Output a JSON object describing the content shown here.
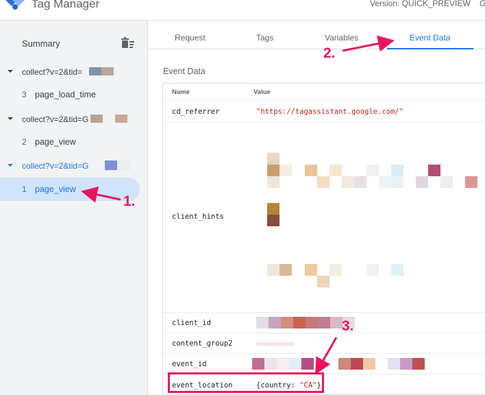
{
  "header": {
    "app_title": "Tag Manager",
    "version": "Version: QUICK_PREVIEW",
    "trailing": "G"
  },
  "sidebar": {
    "summary_label": "Summary",
    "clear_icon": "clear-list-icon",
    "requests": [
      {
        "label": "collect?v=2&tid=",
        "events": [
          {
            "number": "3",
            "name": "page_load_time"
          }
        ]
      },
      {
        "label": "collect?v=2&tid=G",
        "events": [
          {
            "number": "2",
            "name": "page_view"
          }
        ]
      },
      {
        "label": "collect?v=2&tid=G",
        "active": true,
        "events": [
          {
            "number": "1",
            "name": "page_view",
            "selected": true
          }
        ]
      }
    ]
  },
  "tabs": [
    {
      "label": "Request"
    },
    {
      "label": "Tags"
    },
    {
      "label": "Variables"
    },
    {
      "label": "Event Data",
      "active": true
    }
  ],
  "panel": {
    "title": "Event Data",
    "columns": {
      "name": "Name",
      "value": "Value"
    },
    "rows": [
      {
        "name": "cd_referrer",
        "value": "\"https://tagassistant.google.com/\""
      },
      {
        "name": "client_hints",
        "value": ""
      },
      {
        "name": "client_id",
        "value": ""
      },
      {
        "name": "content_group2",
        "value": ""
      },
      {
        "name": "event_id",
        "value": ""
      },
      {
        "name": "event_location",
        "value_prefix": "{country: ",
        "value_string": "\"CA\"",
        "value_suffix": "}"
      }
    ]
  },
  "annotations": [
    "1.",
    "2.",
    "3."
  ],
  "colors": {
    "accent": "#1a73e8",
    "annotation": "#e8175d",
    "string_value": "#c5221f"
  }
}
